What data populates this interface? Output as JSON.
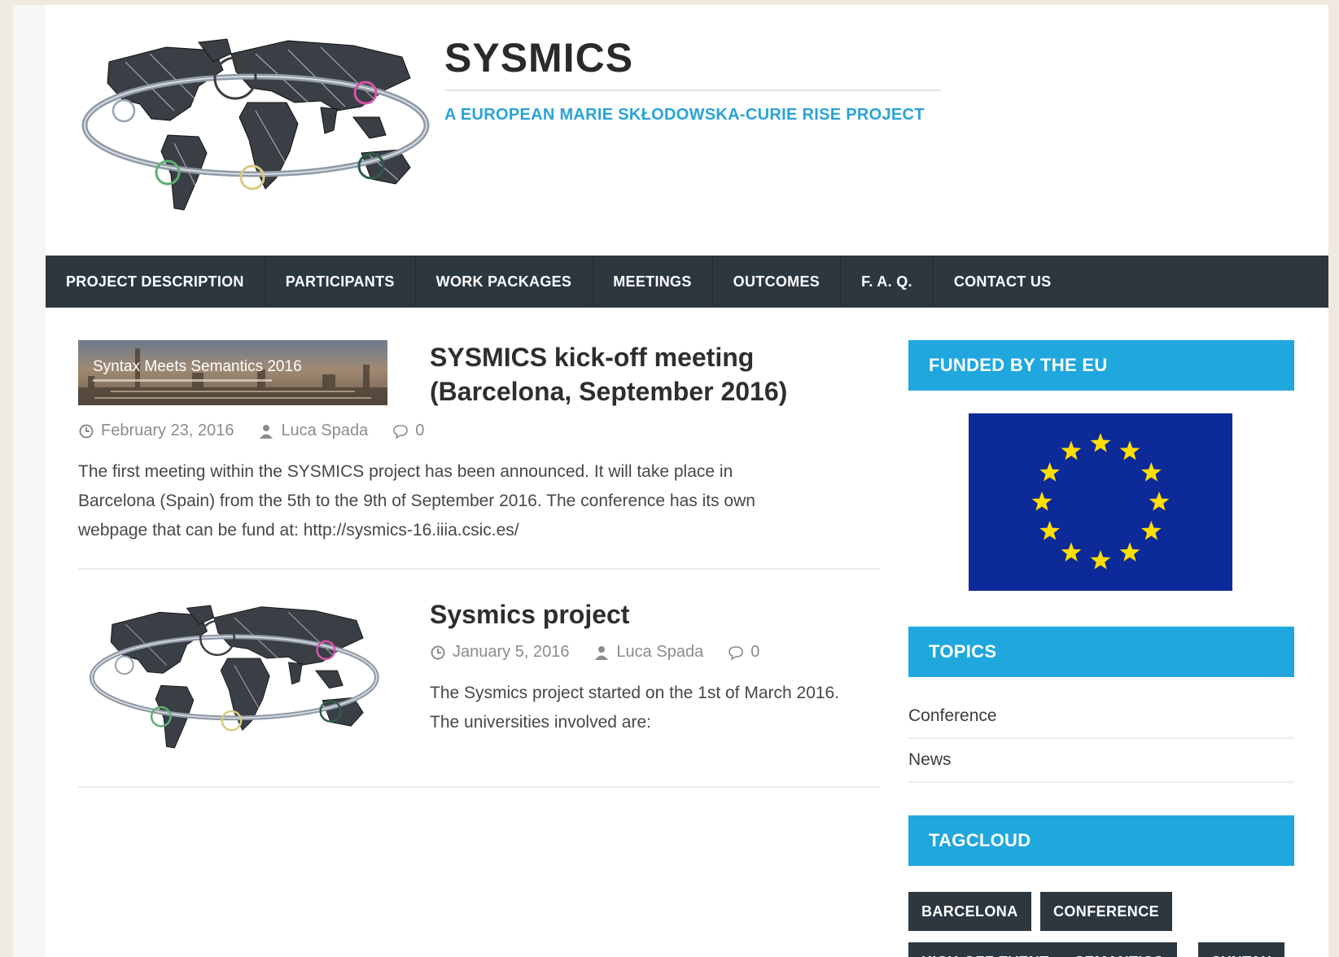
{
  "header": {
    "site_title": "SYSMICS",
    "tagline": "A EUROPEAN MARIE SKŁODOWSKA-CURIE RISE PROJECT"
  },
  "nav": {
    "items": [
      "PROJECT DESCRIPTION",
      "PARTICIPANTS",
      "WORK PACKAGES",
      "MEETINGS",
      "OUTCOMES",
      "F. A. Q.",
      "CONTACT US"
    ]
  },
  "posts": [
    {
      "title_line1": "SYSMICS kick-off meeting",
      "title_line2": "(Barcelona, September 2016)",
      "thumb_text": "Syntax Meets Semantics 2016",
      "date": "February 23, 2016",
      "author": "Luca Spada",
      "comments": "0",
      "excerpt_lines": [
        "The first meeting within the SYSMICS project has been announced.  It will take place in",
        "Barcelona (Spain) from the 5th to the 9th of September 2016. The conference has its own",
        "webpage that can be fund at: http://sysmics-16.iiia.csic.es/"
      ]
    },
    {
      "title": "Sysmics project",
      "date": "January 5, 2016",
      "author": "Luca Spada",
      "comments": "0",
      "excerpt_lines": [
        "The Sysmics project started on the 1st of March 2016.",
        "The universities involved are:"
      ]
    }
  ],
  "sidebar": {
    "funded_title": "FUNDED BY THE EU",
    "topics_title": "TOPICS",
    "topics": [
      "Conference",
      "News"
    ],
    "tagcloud_title": "TAGCLOUD",
    "tags": [
      "BARCELONA",
      "CONFERENCE",
      "KICK-OFF EVENT",
      "SEMANTICS",
      "SYNTAX"
    ]
  },
  "colors": {
    "accent": "#1fa7de",
    "nav_bg": "#2c3740",
    "eu_blue": "#0d2a99",
    "eu_star": "#ffde00"
  },
  "icons": [
    "clock-icon",
    "user-icon",
    "comment-icon",
    "world-map-logo",
    "eu-flag"
  ]
}
